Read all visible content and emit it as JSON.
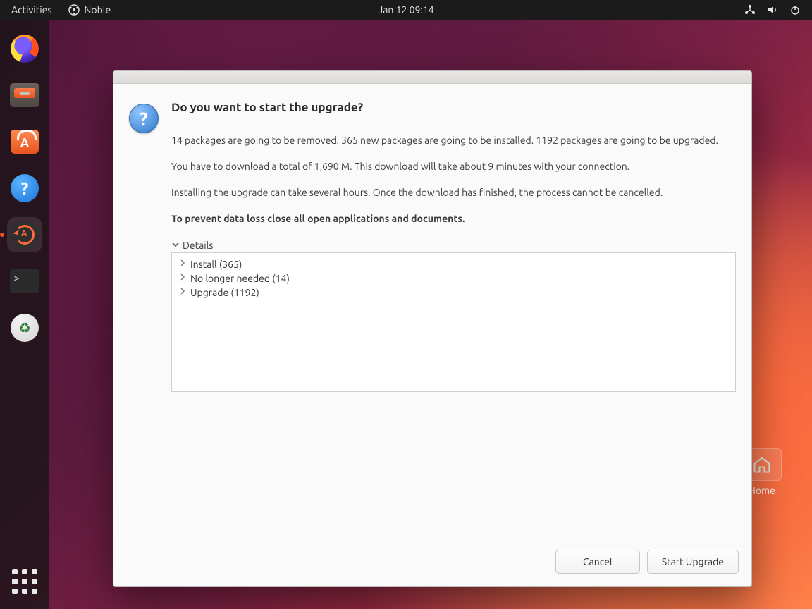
{
  "topbar": {
    "activities": "Activities",
    "app_name": "Noble",
    "clock": "Jan 12  09:14"
  },
  "dock": {
    "items": [
      {
        "name": "firefox",
        "label": "Firefox"
      },
      {
        "name": "files",
        "label": "Files"
      },
      {
        "name": "software",
        "label": "Ubuntu Software"
      },
      {
        "name": "help",
        "label": "Help"
      },
      {
        "name": "updater",
        "label": "Software Updater"
      },
      {
        "name": "terminal",
        "label": "Terminal"
      },
      {
        "name": "trash",
        "label": "Trash"
      }
    ]
  },
  "desktop": {
    "home_label": "Home"
  },
  "dialog": {
    "title": "Do you want to start the upgrade?",
    "line1": "14 packages are going to be removed. 365 new packages are going to be installed. 1192 packages are going to be upgraded.",
    "line2": "You have to download a total of 1,690 M. This download will take about 9 minutes with your connection.",
    "line3": "Installing the upgrade can take several hours. Once the download has finished, the process cannot be cancelled.",
    "warning": "To prevent data loss close all open applications and documents.",
    "details_label": "Details",
    "tree": {
      "install": "Install (365)",
      "no_longer": "No longer needed (14)",
      "upgrade": "Upgrade (1192)"
    },
    "cancel": "Cancel",
    "start": "Start Upgrade"
  }
}
